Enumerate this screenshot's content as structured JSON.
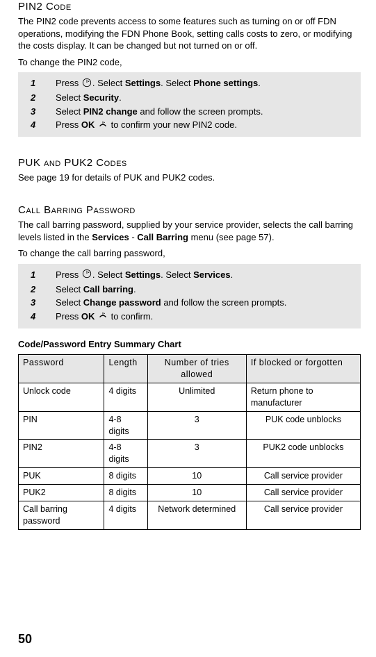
{
  "pin2": {
    "heading": "PIN2 Code",
    "intro": "The PIN2 code prevents access to some features such as turning on or off FDN operations, modifying the FDN Phone Book, setting calls costs to zero, or modifying the costs display. It can be changed but not turned on or off.",
    "lead": "To change the PIN2 code,",
    "steps": [
      {
        "n": "1",
        "pre": "Press ",
        "post1": ". Select ",
        "b1": "Settings",
        "post2": ". Select ",
        "b2": "Phone settings",
        "post3": "."
      },
      {
        "n": "2",
        "pre": "Select ",
        "b1": "Security",
        "post1": "."
      },
      {
        "n": "3",
        "pre": "Select ",
        "b1": "PIN2 change",
        "post1": " and follow the screen prompts."
      },
      {
        "n": "4",
        "pre": "Press ",
        "b1": "OK",
        "post1": " ",
        "post2": " to confirm your new PIN2 code."
      }
    ]
  },
  "puk": {
    "heading": "PUK and PUK2 Codes",
    "body": "See page 19 for details of PUK and PUK2 codes."
  },
  "callbar": {
    "heading": "Call Barring Password",
    "intro_pre": "The call barring password, supplied by your service provider, selects the call barring levels listed in the ",
    "intro_b1": "Services",
    "intro_mid": " - ",
    "intro_b2": "Call Barring",
    "intro_post": " menu (see page 57).",
    "lead": "To change the call barring password,",
    "steps": [
      {
        "n": "1",
        "pre": "Press ",
        "post1": ".  Select ",
        "b1": "Settings",
        "post2": ". Select ",
        "b2": "Services",
        "post3": "."
      },
      {
        "n": "2",
        "pre": "Select ",
        "b1": "Call barring",
        "post1": "."
      },
      {
        "n": "3",
        "pre": "Select ",
        "b1": "Change password",
        "post1": " and follow the screen prompts."
      },
      {
        "n": "4",
        "pre": "Press ",
        "b1": "OK",
        "post1": " ",
        "post2": " to confirm."
      }
    ]
  },
  "chart": {
    "heading": "Code/Password Entry Summary Chart",
    "headers": [
      "Password",
      "Length",
      "Number of tries allowed",
      "If blocked or forgotten"
    ],
    "rows": [
      [
        "Unlock code",
        "4 digits",
        "Unlimited",
        "Return phone to manufacturer"
      ],
      [
        "PIN",
        "4-8 digits",
        "3",
        "PUK code unblocks"
      ],
      [
        "PIN2",
        "4-8 digits",
        "3",
        "PUK2 code unblocks"
      ],
      [
        "PUK",
        "8 digits",
        "10",
        "Call service provider"
      ],
      [
        "PUK2",
        "8 digits",
        "10",
        "Call service provider"
      ],
      [
        "Call barring password",
        "4 digits",
        "Network determined",
        "Call service provider"
      ]
    ]
  },
  "page_number": "50"
}
